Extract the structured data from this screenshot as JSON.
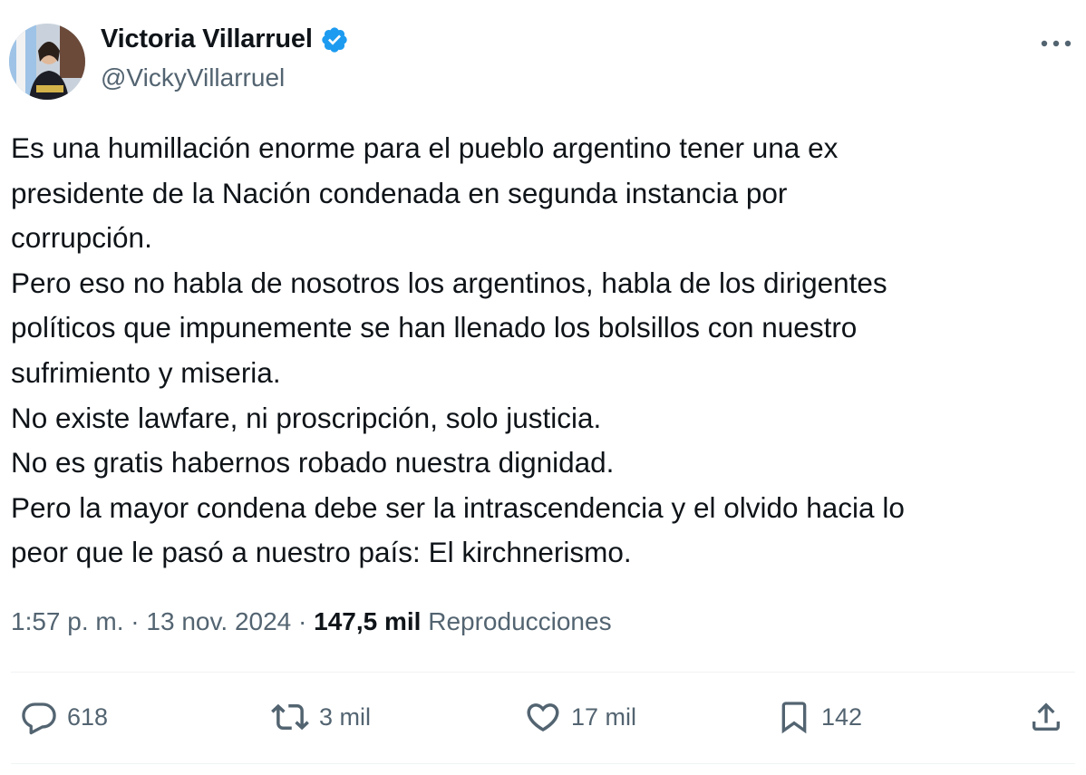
{
  "author": {
    "name": "Victoria Villarruel",
    "handle": "@VickyVillarruel",
    "verified": true,
    "avatar_icon": "profile-photo"
  },
  "tweet": {
    "lines": [
      "Es una humillación enorme para el pueblo argentino tener una ex",
      "presidente de la Nación condenada en segunda instancia por",
      "corrupción.",
      "Pero eso no habla de nosotros los argentinos, habla de los dirigentes",
      "políticos que impunemente se han llenado los bolsillos con nuestro",
      "sufrimiento y miseria.",
      "No existe lawfare, ni proscripción, solo justicia.",
      "No es gratis habernos robado nuestra dignidad.",
      "Pero la mayor condena debe ser la intrascendencia y el olvido hacia lo",
      "peor que le pasó a nuestro país: El kirchnerismo."
    ]
  },
  "meta": {
    "time": "1:57 p. m.",
    "separator": " · ",
    "date": "13 nov. 2024",
    "views_count": "147,5 mil",
    "views_label": "Reproducciones"
  },
  "actions": {
    "replies": "618",
    "reposts": "3 mil",
    "likes": "17 mil",
    "bookmarks": "142"
  },
  "colors": {
    "text": "#0f1419",
    "secondary": "#536471",
    "verified": "#1d9bf0",
    "divider": "#eff3f4"
  }
}
